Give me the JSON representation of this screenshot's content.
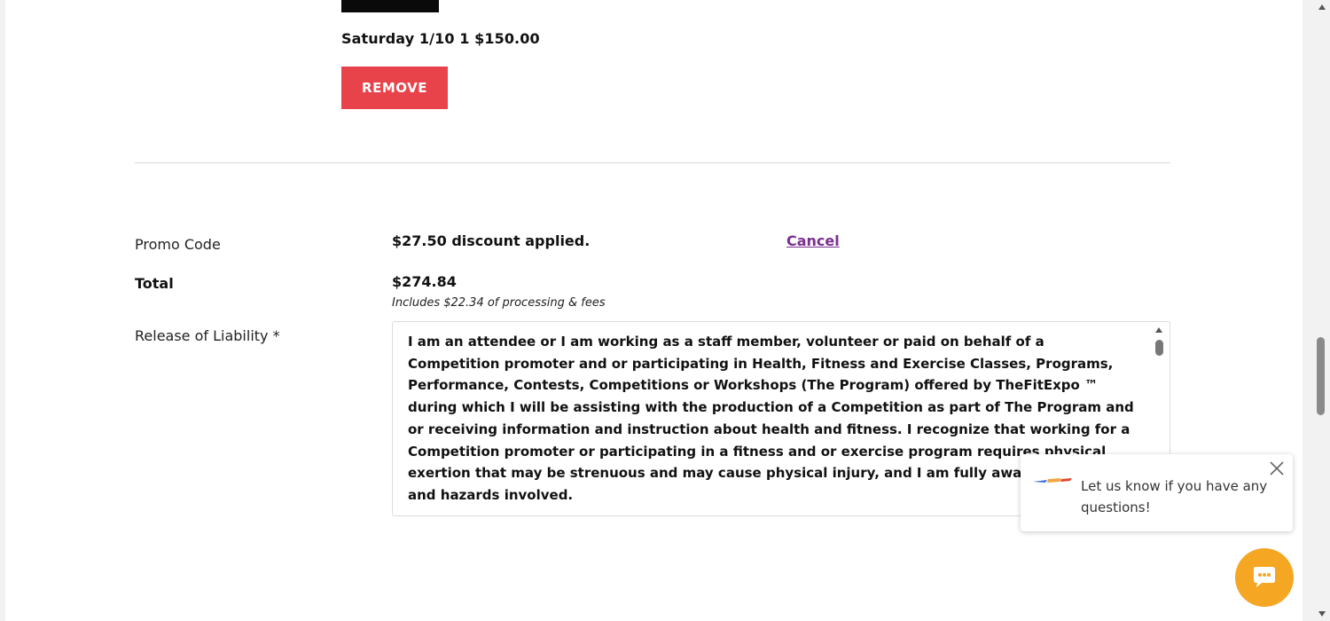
{
  "cart": {
    "line_item": "Saturday 1/10 1 $150.00",
    "remove_label": "REMOVE"
  },
  "summary": {
    "promo_label": "Promo Code",
    "promo_value": "$27.50 discount applied.",
    "cancel_label": "Cancel",
    "total_label": "Total",
    "total_value": "$274.84",
    "fees_note": "Includes $22.34 of processing & fees",
    "release_label": "Release of Liability *",
    "release_text": "I am an attendee or I am working as a staff member, volunteer or paid on behalf of a Competition promoter and or participating in Health, Fitness and Exercise Classes, Programs, Performance, Contests, Competitions or Workshops (The Program) offered by TheFitExpo ™ during which I will be assisting with the production of a Competition as part of The Program and or receiving information and instruction about health and fitness. I recognize that working for a Competition promoter or participating in a fitness and or exercise program requires physical exertion that may be strenuous and may cause physical injury, and I am fully aware of the risks and hazards involved."
  },
  "chat": {
    "message": "Let us know if you have any questions!",
    "logo_icon": "fitexpo-logo",
    "close_icon": "close-icon",
    "bubble_icon": "chat-bubble-icon"
  },
  "colors": {
    "remove_button": "#e8434a",
    "cancel_link": "#7a2f8f",
    "chat_button": "#f5a623"
  }
}
